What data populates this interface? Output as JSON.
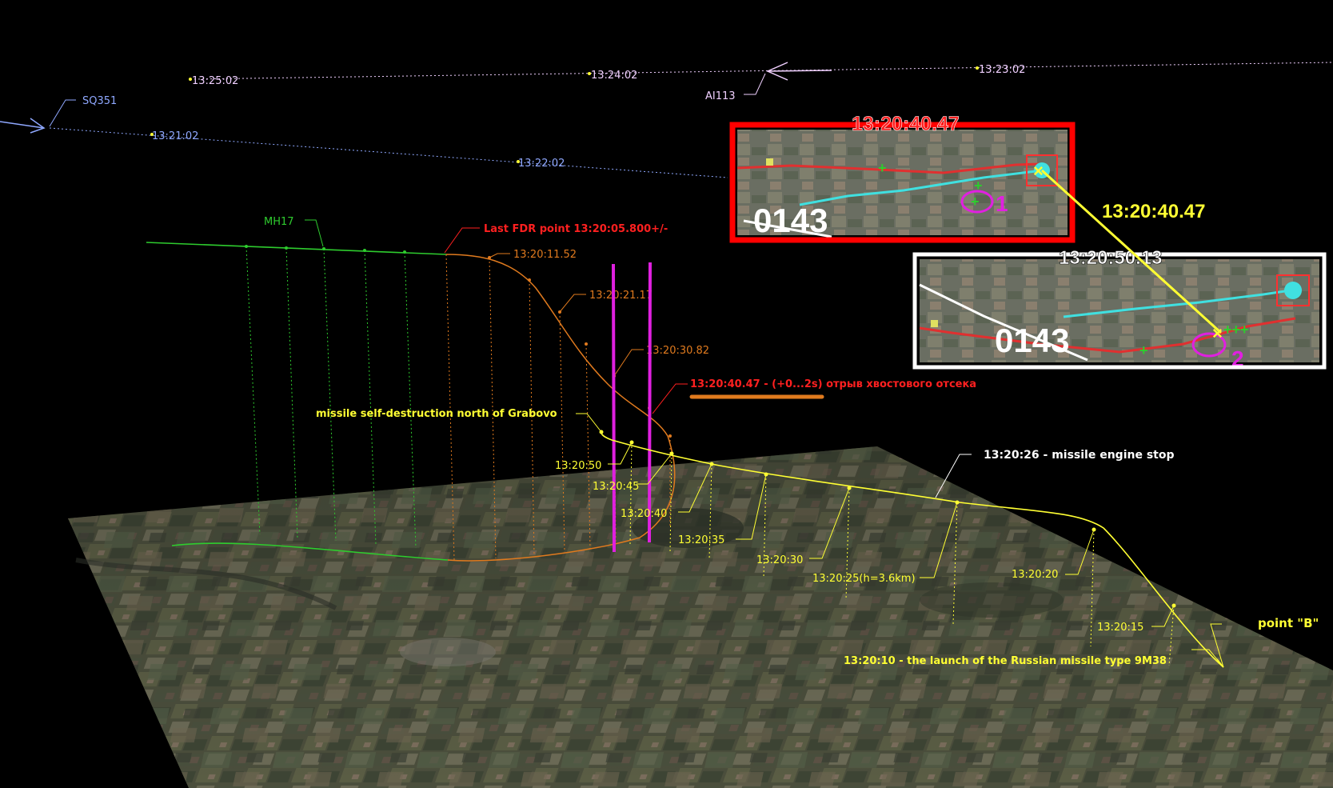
{
  "aircraft": {
    "sq351": "SQ351",
    "ai113": "AI113",
    "mh17": "MH17"
  },
  "sq351_track_times": [
    "13:21:02",
    "13:22:02"
  ],
  "ai113_track_times": [
    "13:23:02",
    "13:24:02",
    "13:25:02"
  ],
  "mh17_times": {
    "last_fdr": "Last FDR point 13:20:05.800+/-",
    "t1": "13:20:11.52",
    "t2": "13:20:21.17",
    "t3": "13:20:30.82",
    "separation": "13:20:40.47 - (+0...2s) отрыв хвостового отсека"
  },
  "missile_labels": {
    "self_destruction": "missile self-destruction north of Grabovo",
    "t50": "13:20:50",
    "t45": "13:20:45",
    "t40": "13:20:40",
    "t35": "13:20:35",
    "t30": "13:20:30",
    "t25": "13:20:25(h=3.6km)",
    "t20": "13:20:20",
    "t15": "13:20:15",
    "launch": "13:20:10 - the launch of the Russian missile type 9M38",
    "engine_stop": "13:20:26 - missile engine stop",
    "point_b": "point \"B\""
  },
  "inset_1": {
    "title": "13:20:40.47",
    "code": "0143",
    "marker": "1"
  },
  "inset_2": {
    "title": "13:20:50.13",
    "code": "0143",
    "marker": "2"
  },
  "connector_label": "13:20:40.47",
  "colors": {
    "mh17": "#2ecc2e",
    "mh17_breakup": "#e07a1e",
    "missile": "#ffff33",
    "sq351": "#8fa8ff",
    "ai113": "#f0d0ff",
    "magenta": "#e020e0",
    "red": "#ff2020",
    "inset1_border": "#ff0000",
    "inset2_border": "#ffffff"
  }
}
